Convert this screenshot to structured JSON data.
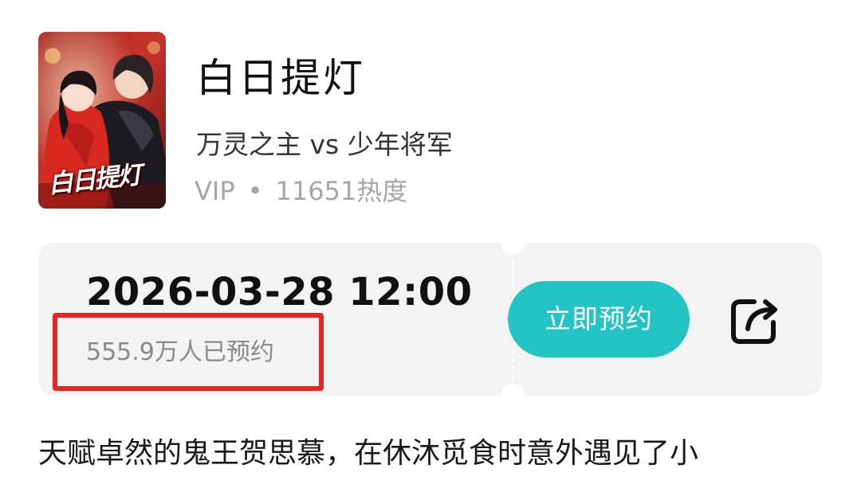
{
  "show": {
    "poster_text": "白日提灯",
    "title": "白日提灯",
    "tagline": "万灵之主 vs 少年将军",
    "badge": "VIP",
    "separator": "•",
    "heat": "11651热度"
  },
  "reservation": {
    "release_time": "2026-03-28 12:00",
    "reserved_count": "555.9万人已预约",
    "reserve_button_label": "立即预约",
    "share_icon": "share-icon"
  },
  "description": {
    "text": "天赋卓然的鬼王贺思慕，在休沐觅食时意外遇见了小"
  },
  "colors": {
    "accent_teal": "#22c4c4",
    "highlight_red": "#e8251f",
    "card_background": "#f3f3f3",
    "meta_gray": "#a6a6a6"
  }
}
